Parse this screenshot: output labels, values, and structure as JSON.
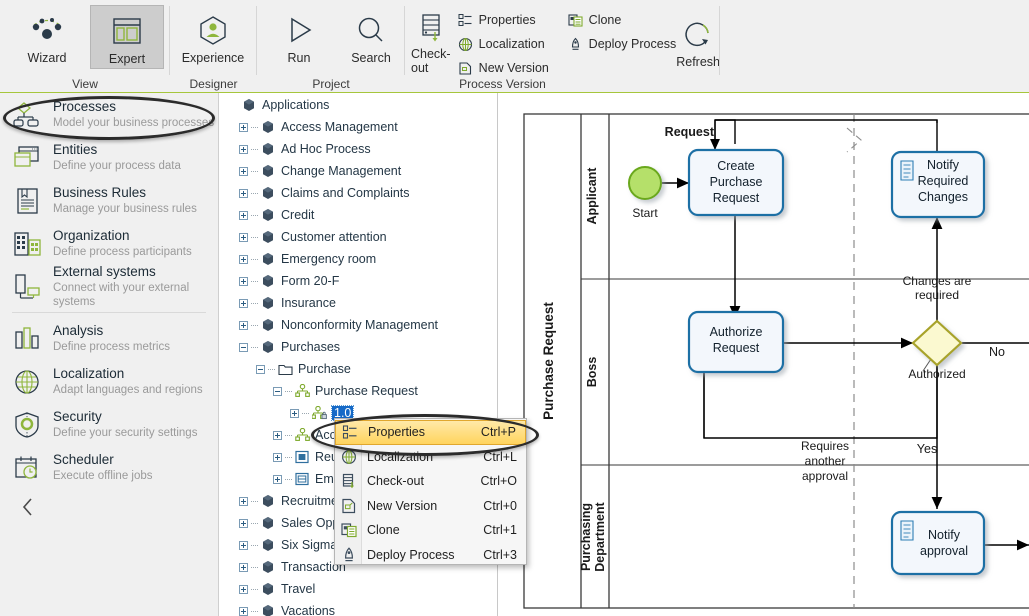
{
  "ribbon": {
    "groups": [
      {
        "name": "View",
        "label": "View",
        "buttons": [
          {
            "label": "Wizard",
            "icon": "wizard-icon",
            "selected": false
          },
          {
            "label": "Expert",
            "icon": "expert-icon",
            "selected": true
          }
        ]
      },
      {
        "name": "Designer",
        "label": "Designer",
        "buttons": [
          {
            "label": "Experience",
            "icon": "experience-icon",
            "selected": false
          }
        ]
      },
      {
        "name": "Project",
        "label": "Project",
        "buttons": [
          {
            "label": "Run",
            "icon": "run-icon",
            "selected": false
          },
          {
            "label": "Search",
            "icon": "search-icon",
            "selected": false
          }
        ]
      },
      {
        "name": "Process Version",
        "label": "Process Version",
        "buttons": [
          {
            "label": "Check-out",
            "icon": "check-out-icon",
            "selected": false
          },
          {
            "label": "Refresh",
            "icon": "refresh-icon",
            "selected": false
          }
        ],
        "small_buttons": [
          {
            "label": "Properties",
            "icon": "properties-icon"
          },
          {
            "label": "Localization",
            "icon": "localization-icon"
          },
          {
            "label": "New Version",
            "icon": "new-version-icon"
          },
          {
            "label": "Clone",
            "icon": "clone-icon"
          },
          {
            "label": "Deploy Process",
            "icon": "deploy-process-icon"
          }
        ]
      }
    ]
  },
  "sidebar": {
    "items": [
      {
        "title": "Processes",
        "subtitle": "Model your business processes",
        "icon": "processes-icon",
        "highlighted": true
      },
      {
        "title": "Entities",
        "subtitle": "Define your process data",
        "icon": "entities-icon",
        "highlighted": false
      },
      {
        "title": "Business Rules",
        "subtitle": "Manage your business rules",
        "icon": "business-rules-icon",
        "highlighted": false
      },
      {
        "title": "Organization",
        "subtitle": "Define process participants",
        "icon": "organization-icon",
        "highlighted": false
      },
      {
        "title": "External systems",
        "subtitle": "Connect with your external systems",
        "icon": "external-systems-icon",
        "highlighted": false
      },
      {
        "title": "Analysis",
        "subtitle": "Define process metrics",
        "icon": "analysis-icon",
        "highlighted": false
      },
      {
        "title": "Localization",
        "subtitle": "Adapt languages and regions",
        "icon": "localization-icon",
        "highlighted": false
      },
      {
        "title": "Security",
        "subtitle": "Define your security settings",
        "icon": "security-icon",
        "highlighted": false
      },
      {
        "title": "Scheduler",
        "subtitle": "Execute offline jobs",
        "icon": "scheduler-icon",
        "highlighted": false
      }
    ],
    "collapse_icon": "chevron-left-icon"
  },
  "tree": {
    "nodes": [
      {
        "label": "Applications",
        "indent": 0,
        "expander": "none",
        "icon": "application-icon",
        "selected": false
      },
      {
        "label": "Access Management",
        "indent": 1,
        "expander": "plus",
        "icon": "application-icon",
        "selected": false
      },
      {
        "label": "Ad Hoc Process",
        "indent": 1,
        "expander": "plus",
        "icon": "application-icon",
        "selected": false
      },
      {
        "label": "Change Management",
        "indent": 1,
        "expander": "plus",
        "icon": "application-icon",
        "selected": false
      },
      {
        "label": "Claims and Complaints",
        "indent": 1,
        "expander": "plus",
        "icon": "application-icon",
        "selected": false
      },
      {
        "label": "Credit",
        "indent": 1,
        "expander": "plus",
        "icon": "application-icon",
        "selected": false
      },
      {
        "label": "Customer attention",
        "indent": 1,
        "expander": "plus",
        "icon": "application-icon",
        "selected": false
      },
      {
        "label": "Emergency room",
        "indent": 1,
        "expander": "plus",
        "icon": "application-icon",
        "selected": false
      },
      {
        "label": "Form 20-F",
        "indent": 1,
        "expander": "plus",
        "icon": "application-icon",
        "selected": false
      },
      {
        "label": "Insurance",
        "indent": 1,
        "expander": "plus",
        "icon": "application-icon",
        "selected": false
      },
      {
        "label": "Nonconformity Management",
        "indent": 1,
        "expander": "plus",
        "icon": "application-icon",
        "selected": false
      },
      {
        "label": "Purchases",
        "indent": 1,
        "expander": "minus",
        "icon": "application-icon",
        "selected": false
      },
      {
        "label": "Purchase",
        "indent": 2,
        "expander": "minus",
        "icon": "folder-icon",
        "selected": false
      },
      {
        "label": "Purchase Request",
        "indent": 3,
        "expander": "minus",
        "icon": "process-icon",
        "selected": false
      },
      {
        "label": "1.0",
        "indent": 4,
        "expander": "plus",
        "icon": "process-lock-icon",
        "selected": true
      },
      {
        "label": "Accounting",
        "indent": 3,
        "expander": "plus",
        "icon": "process-icon",
        "selected": false
      },
      {
        "label": "Reusable",
        "indent": 3,
        "expander": "plus",
        "icon": "reusable-icon",
        "selected": false
      },
      {
        "label": "Embedded",
        "indent": 3,
        "expander": "plus",
        "icon": "embedded-icon",
        "selected": false
      },
      {
        "label": "Recruitment A",
        "indent": 1,
        "expander": "plus",
        "icon": "application-icon",
        "selected": false
      },
      {
        "label": "Sales Opportu",
        "indent": 1,
        "expander": "plus",
        "icon": "application-icon",
        "selected": false
      },
      {
        "label": "Six Sigma",
        "indent": 1,
        "expander": "plus",
        "icon": "application-icon",
        "selected": false
      },
      {
        "label": "Transaction",
        "indent": 1,
        "expander": "plus",
        "icon": "application-icon",
        "selected": false
      },
      {
        "label": "Travel",
        "indent": 1,
        "expander": "plus",
        "icon": "application-icon",
        "selected": false
      },
      {
        "label": "Vacations",
        "indent": 1,
        "expander": "plus",
        "icon": "application-icon",
        "selected": false
      }
    ]
  },
  "context_menu": {
    "items": [
      {
        "label": "Properties",
        "shortcut": "Ctrl+P",
        "icon": "properties-icon",
        "highlighted": true
      },
      {
        "label": "Localization",
        "shortcut": "Ctrl+L",
        "icon": "localization-icon",
        "highlighted": false
      },
      {
        "label": "Check-out",
        "shortcut": "Ctrl+O",
        "icon": "check-out-icon",
        "highlighted": false
      },
      {
        "label": "New Version",
        "shortcut": "Ctrl+0",
        "icon": "new-version-icon",
        "highlighted": false
      },
      {
        "label": "Clone",
        "shortcut": "Ctrl+1",
        "icon": "clone-icon",
        "highlighted": false
      },
      {
        "label": "Deploy Process",
        "shortcut": "Ctrl+3",
        "icon": "deploy-process-icon",
        "highlighted": false
      }
    ]
  },
  "diagram": {
    "pool_label": "Purchase Request",
    "lanes": [
      {
        "label": "Applicant"
      },
      {
        "label": "Boss"
      },
      {
        "label": "Purchasing\nDepartment"
      }
    ],
    "nodes": [
      {
        "id": "start",
        "type": "start-event",
        "label": "Start"
      },
      {
        "id": "create",
        "type": "task",
        "label": "Create\nPurchase\nRequest"
      },
      {
        "id": "notifyc",
        "type": "script-task",
        "label": "Notify\nRequired\nChanges"
      },
      {
        "id": "auth",
        "type": "task",
        "label": "Authorize\nRequest"
      },
      {
        "id": "gw",
        "type": "gateway",
        "label": "Authorized"
      },
      {
        "id": "notifya",
        "type": "script-task",
        "label": "Notify\napproval"
      }
    ],
    "edge_labels": [
      {
        "text": "Request"
      },
      {
        "text": "Changes are\nrequired"
      },
      {
        "text": "No"
      },
      {
        "text": "Yes"
      },
      {
        "text": "Requires\nanother\napproval"
      }
    ],
    "colors": {
      "task_border": "#1f6fa5",
      "task_fill": "#f3f7fc",
      "start_fill": "#b5e06a",
      "start_border": "#6aa81e",
      "gateway_fill": "#fbf9d0",
      "gateway_border": "#a8a32b",
      "lane_border": "#3a3a3a"
    }
  }
}
